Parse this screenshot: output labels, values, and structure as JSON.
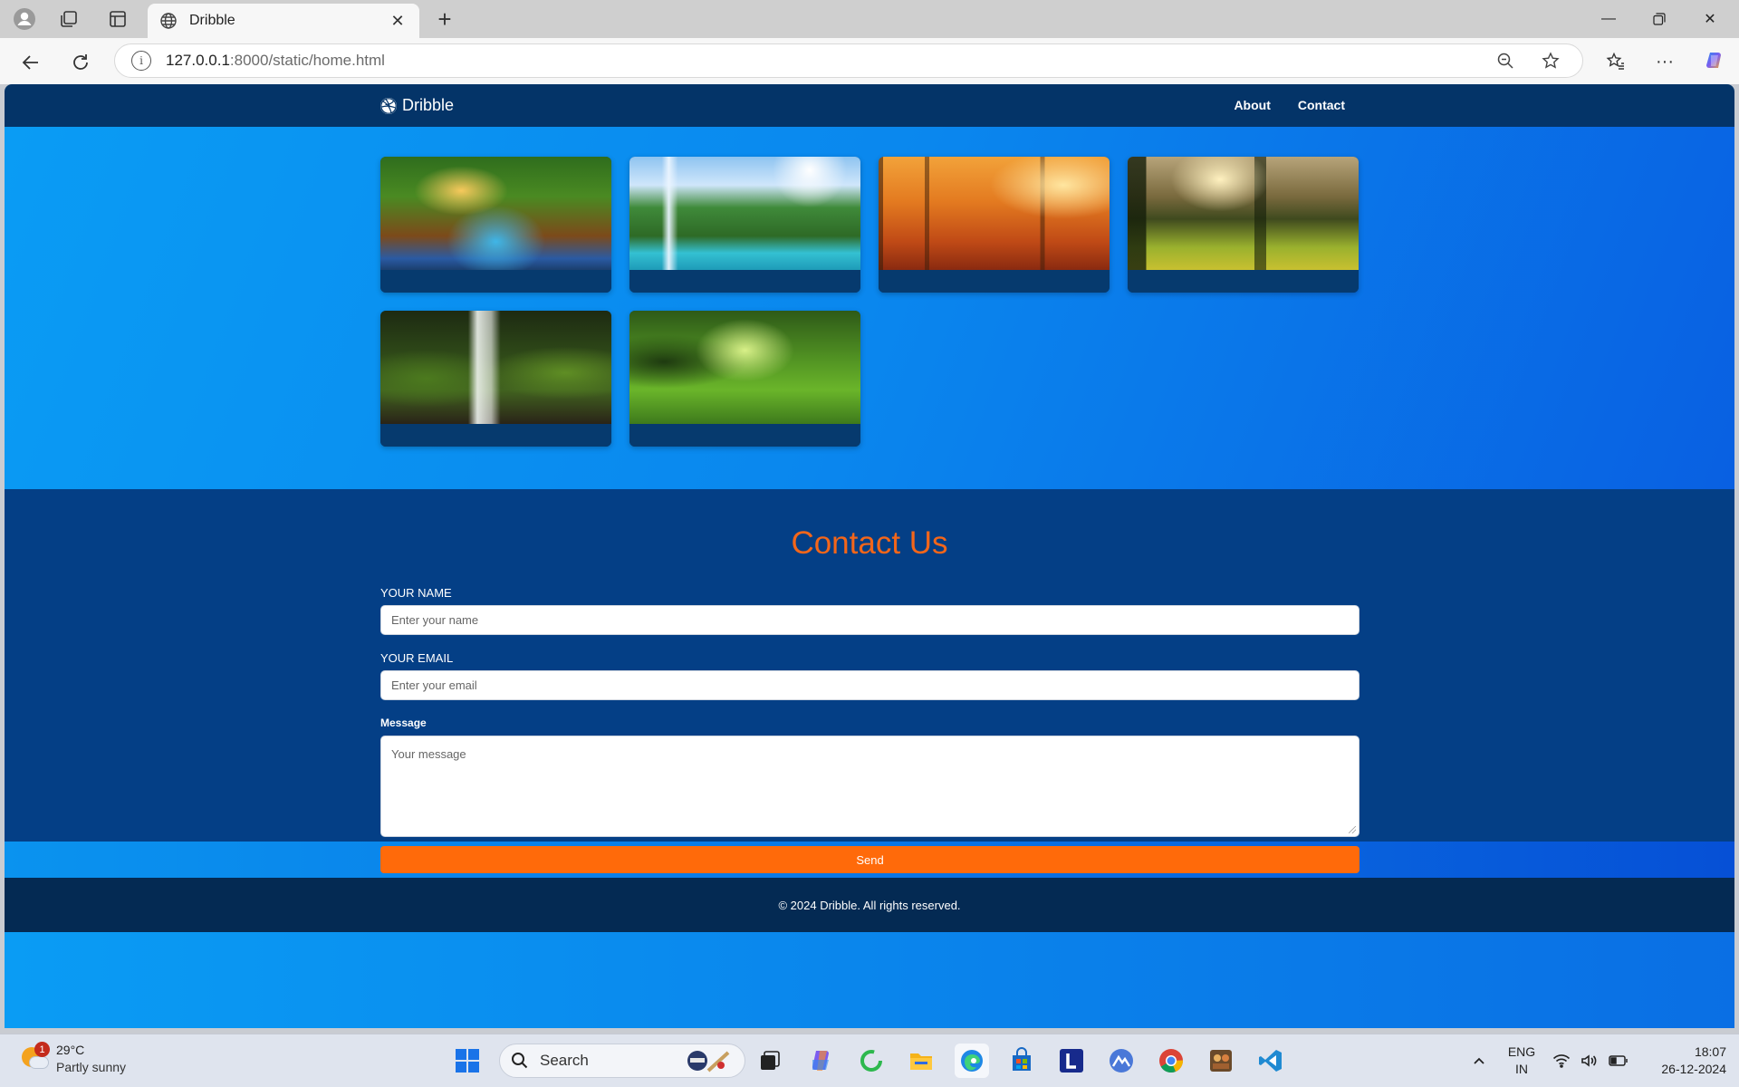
{
  "browser": {
    "tab_title": "Dribble",
    "url_host": "127.0.0.1",
    "url_rest": ":8000/static/home.html"
  },
  "site": {
    "brand": "Dribble",
    "nav": [
      "About",
      "Contact"
    ],
    "gallery": [
      {
        "icon": "forest-stream-image"
      },
      {
        "icon": "waterfall-lake-image"
      },
      {
        "icon": "autumn-forest-image"
      },
      {
        "icon": "sunlit-meadow-image"
      },
      {
        "icon": "mossy-waterfall-image"
      },
      {
        "icon": "green-forest-path-image"
      }
    ],
    "contact": {
      "title": "Contact Us",
      "name_label": "YOUR NAME",
      "name_placeholder": "Enter your name",
      "email_label": "YOUR EMAIL",
      "email_placeholder": "Enter your email",
      "message_label": "Message",
      "message_placeholder": "Your message",
      "send_label": "Send"
    },
    "footer": "© 2024 Dribble. All rights reserved."
  },
  "taskbar": {
    "weather_temp": "29°C",
    "weather_desc": "Partly sunny",
    "weather_badge": "1",
    "search_label": "Search",
    "lang_1": "ENG",
    "lang_2": "IN",
    "time": "18:07",
    "date": "26-12-2024"
  },
  "colors": {
    "header": "#043468",
    "contact_bg": "#043f86",
    "accent": "#f3661a",
    "send": "#ff6a0a",
    "footer": "#042a53"
  }
}
